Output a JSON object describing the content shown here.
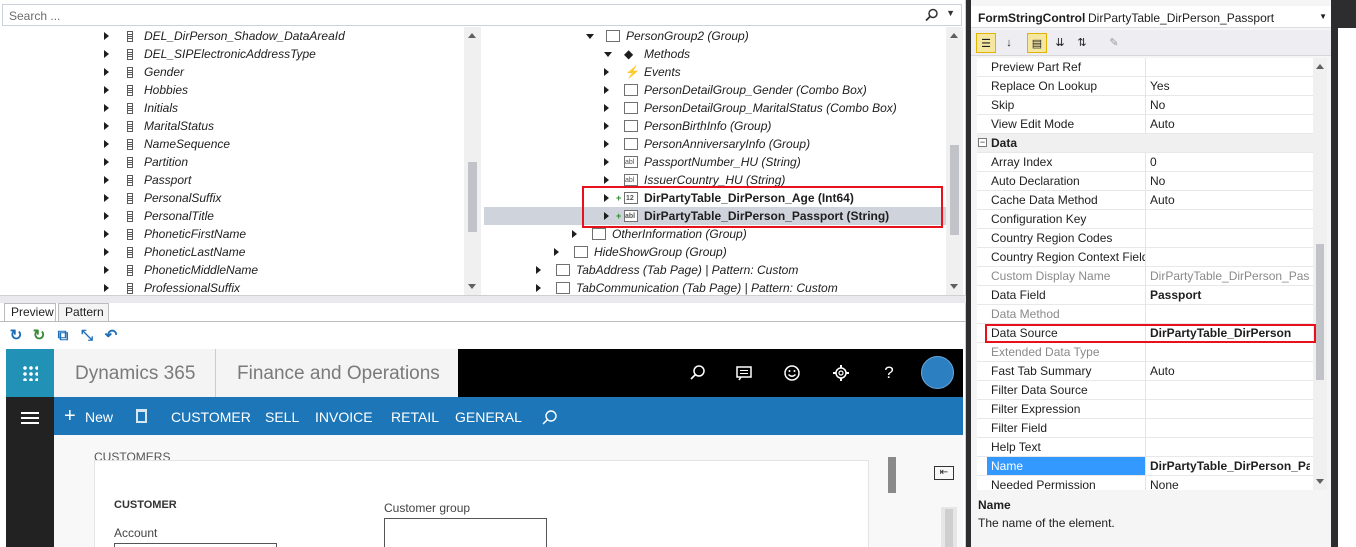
{
  "search": {
    "placeholder": "Search ..."
  },
  "left_tree": [
    "DEL_DirPerson_Shadow_DataAreaId",
    "DEL_SIPElectronicAddressType",
    "Gender",
    "Hobbies",
    "Initials",
    "MaritalStatus",
    "NameSequence",
    "Partition",
    "Passport",
    "PersonalSuffix",
    "PersonalTitle",
    "PhoneticFirstName",
    "PhoneticLastName",
    "PhoneticMiddleName",
    "ProfessionalSuffix"
  ],
  "right_tree": [
    {
      "label": "PersonGroup2 (Group)",
      "icon": "group-icon"
    },
    {
      "label": "Methods",
      "icon": "methods-icon"
    },
    {
      "label": "Events",
      "icon": "events-icon"
    },
    {
      "label": "PersonDetailGroup_Gender (Combo Box)",
      "icon": "combobox-icon"
    },
    {
      "label": "PersonDetailGroup_MaritalStatus (Combo Box)",
      "icon": "combobox-icon"
    },
    {
      "label": "PersonBirthInfo (Group)",
      "icon": "group-icon"
    },
    {
      "label": "PersonAnniversaryInfo (Group)",
      "icon": "group-icon"
    },
    {
      "label": "PassportNumber_HU (String)",
      "icon": "string-icon"
    },
    {
      "label": "IssuerCountry_HU (String)",
      "icon": "string-icon"
    },
    {
      "label": "DirPartyTable_DirPerson_Age (Int64)",
      "icon": "int64-icon"
    },
    {
      "label": "DirPartyTable_DirPerson_Passport (String)",
      "icon": "string-icon"
    },
    {
      "label": "OtherInformation (Group)",
      "icon": "group-icon"
    },
    {
      "label": "HideShowGroup (Group)",
      "icon": "group-icon"
    },
    {
      "label": "TabAddress (Tab Page) | Pattern: Custom",
      "icon": "tabpage-icon"
    },
    {
      "label": "TabCommunication (Tab Page) | Pattern: Custom",
      "icon": "tabpage-icon"
    }
  ],
  "preview_tabs": [
    "Preview",
    "Pattern"
  ],
  "d365": {
    "brand": "Dynamics 365",
    "app": "Finance and Operations",
    "nav": {
      "new": "New",
      "items": [
        "CUSTOMER",
        "SELL",
        "INVOICE",
        "RETAIL",
        "GENERAL"
      ]
    },
    "section_label": "CUSTOMERS",
    "customer_header": "CUSTOMER",
    "account_label": "Account",
    "customer_group_label": "Customer group",
    "pin_glyph": "⇤"
  },
  "properties": {
    "type": "FormStringControl",
    "name": "DirPartyTable_DirPerson_Passport",
    "rows": [
      {
        "name": "Preview Part Ref",
        "value": ""
      },
      {
        "name": "Replace On Lookup",
        "value": "Yes"
      },
      {
        "name": "Skip",
        "value": "No"
      },
      {
        "name": "View Edit Mode",
        "value": "Auto"
      },
      {
        "name": "Data",
        "value": "",
        "category": true
      },
      {
        "name": "Array Index",
        "value": "0"
      },
      {
        "name": "Auto Declaration",
        "value": "No"
      },
      {
        "name": "Cache Data Method",
        "value": "Auto"
      },
      {
        "name": "Configuration Key",
        "value": ""
      },
      {
        "name": "Country Region Codes",
        "value": ""
      },
      {
        "name": "Country Region Context Fields",
        "value": ""
      },
      {
        "name": "Custom Display Name",
        "value": "DirPartyTable_DirPerson_Passport",
        "gray": true
      },
      {
        "name": "Data Field",
        "value": "Passport",
        "bold": true
      },
      {
        "name": "Data Method",
        "value": "",
        "gray": true
      },
      {
        "name": "Data Source",
        "value": "DirPartyTable_DirPerson",
        "bold": true
      },
      {
        "name": "Extended Data Type",
        "value": "",
        "gray": true
      },
      {
        "name": "Fast Tab Summary",
        "value": "Auto"
      },
      {
        "name": "Filter Data Source",
        "value": ""
      },
      {
        "name": "Filter Expression",
        "value": ""
      },
      {
        "name": "Filter Field",
        "value": ""
      },
      {
        "name": "Help Text",
        "value": ""
      },
      {
        "name": "Name",
        "value": "DirPartyTable_DirPerson_Passport",
        "bold": true,
        "selected": true
      },
      {
        "name": "Needed Permission",
        "value": "None"
      }
    ],
    "description_title": "Name",
    "description_text": "The name of the element."
  },
  "colors": {
    "accent": "#2192b5",
    "nav": "#1d76b8",
    "highlight": "#e8101a",
    "selected": "#3399ff"
  }
}
